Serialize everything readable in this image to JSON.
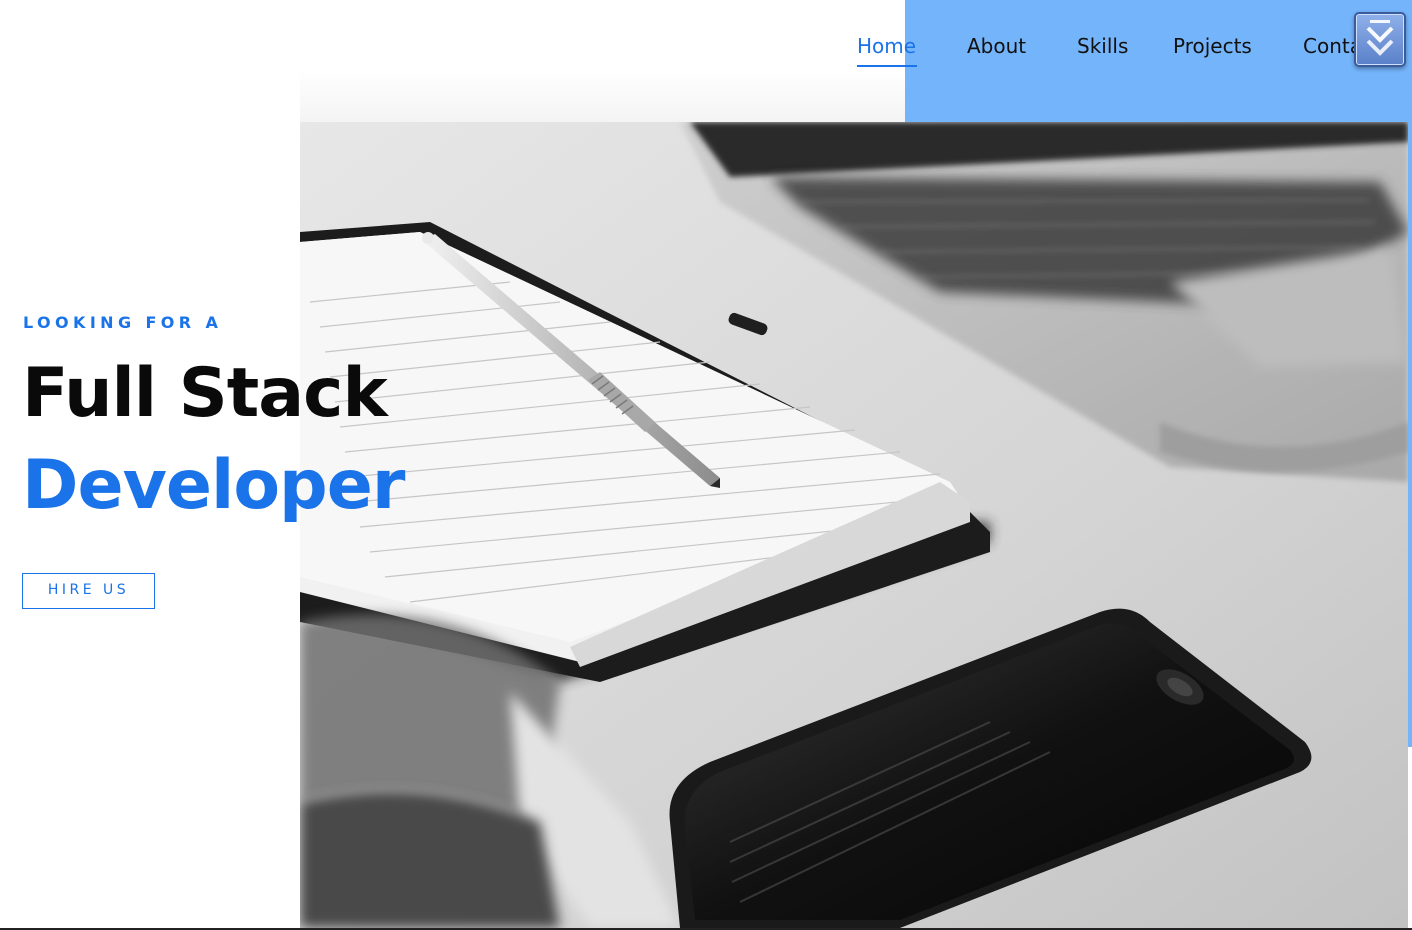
{
  "nav": {
    "items": [
      {
        "label": "Home",
        "active": true
      },
      {
        "label": "About",
        "active": false
      },
      {
        "label": "Skills",
        "active": false
      },
      {
        "label": "Projects",
        "active": false
      },
      {
        "label": "Contact",
        "active": false
      }
    ],
    "accent_color": "#1a73e8",
    "panel_color": "#74b4fb"
  },
  "scroll_button": {
    "icon": "double-chevron-down-icon"
  },
  "hero": {
    "kicker": "LOOKING FOR A",
    "title_line1": "Full Stack",
    "title_line2": "Developer",
    "cta_label": "HIRE US",
    "image": "desk-workspace-photo"
  }
}
